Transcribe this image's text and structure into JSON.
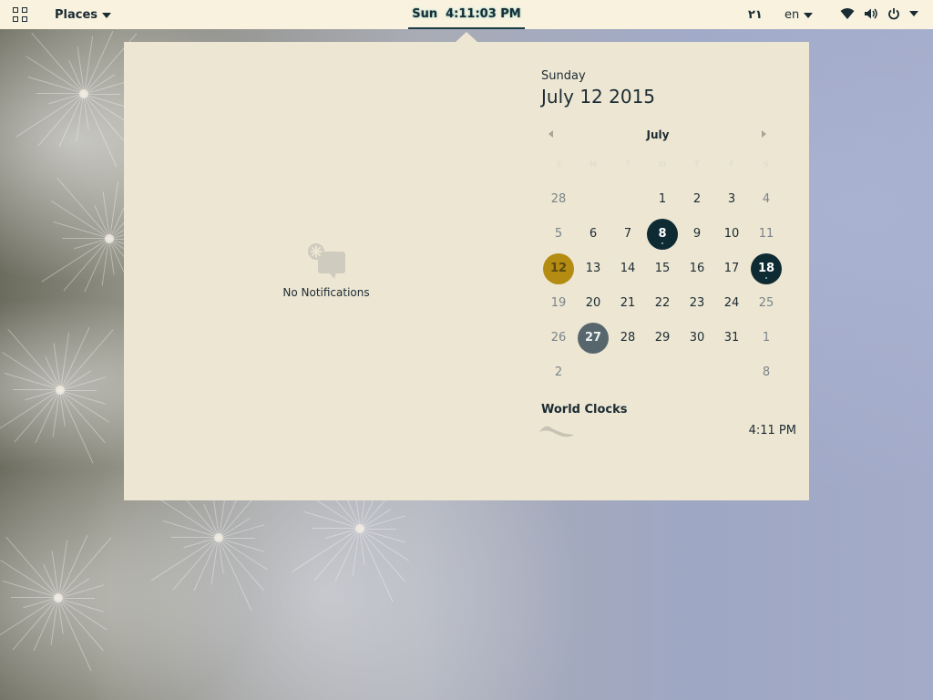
{
  "top_bar": {
    "places_label": "Places",
    "clock_day": "Sun",
    "clock_time": "4:11:03 PM",
    "arabic_date": "٢١",
    "input_language": "en",
    "icons": [
      "activities-grid-icon",
      "wifi-icon",
      "volume-icon",
      "power-icon",
      "chevron-down-icon"
    ]
  },
  "notifications": {
    "empty_label": "No Notifications",
    "icon": "notification-bubble-icon"
  },
  "calendar": {
    "day_name": "Sunday",
    "full_date": "July 12 2015",
    "month_label": "July",
    "weekdays": [
      "S",
      "M",
      "T",
      "W",
      "T",
      "F",
      "S"
    ],
    "rows": [
      [
        "28",
        "",
        "",
        "1",
        "2",
        "3",
        "4"
      ],
      [
        "5",
        "6",
        "7",
        "8",
        "9",
        "10",
        "11"
      ],
      [
        "12",
        "13",
        "14",
        "15",
        "16",
        "17",
        "18"
      ],
      [
        "19",
        "20",
        "21",
        "22",
        "23",
        "24",
        "25"
      ],
      [
        "26",
        "27",
        "28",
        "29",
        "30",
        "31",
        "1"
      ],
      [
        "2",
        "",
        "",
        "",
        "",
        "",
        "8"
      ]
    ],
    "selected_day": "12",
    "today_accent_color": "#b38c11",
    "highlight_color": "#0e2a33"
  },
  "world_clocks": {
    "title": "World Clocks",
    "time": "4:11 PM"
  }
}
